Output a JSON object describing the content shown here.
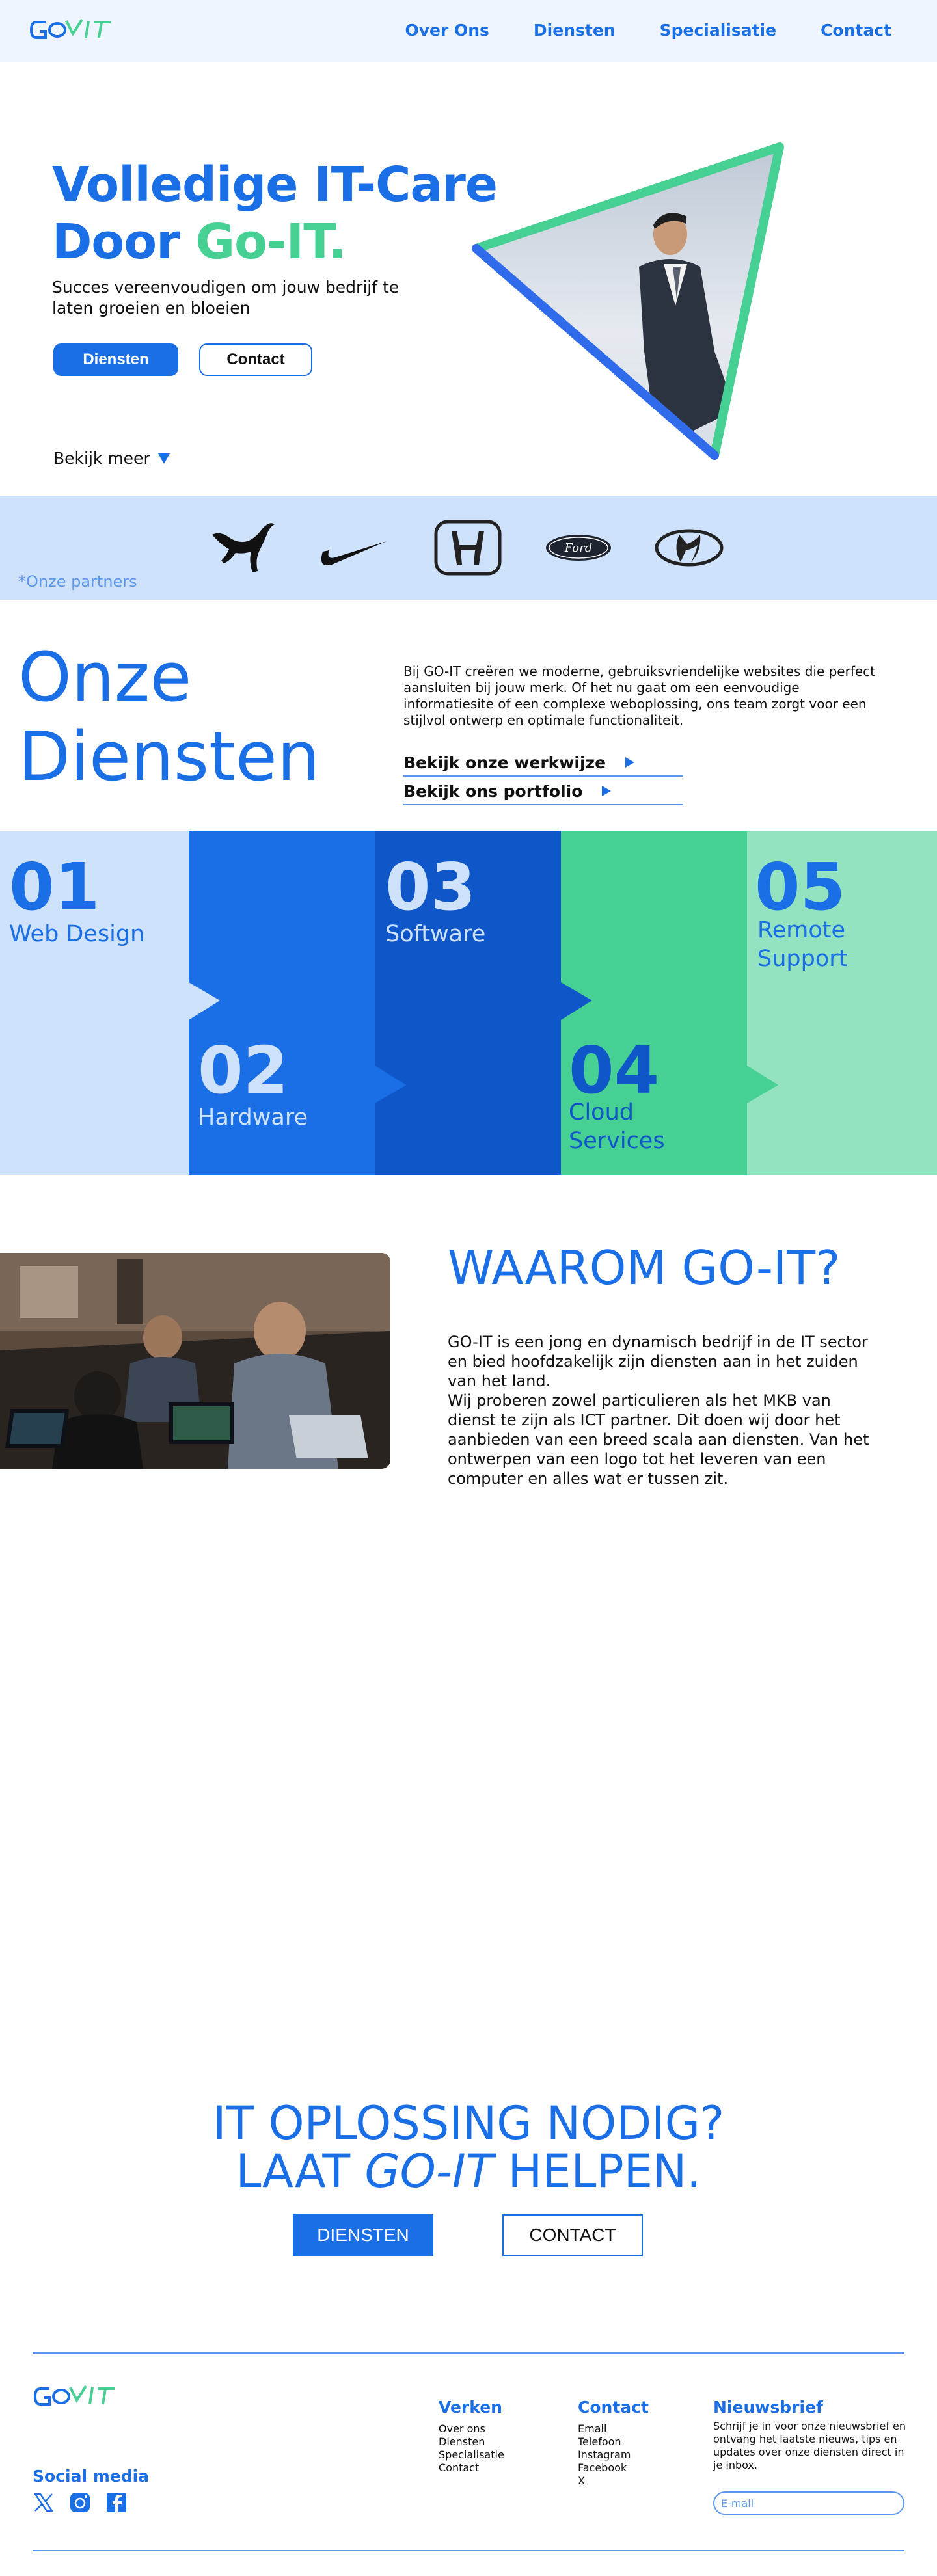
{
  "colors": {
    "primary": "#1A6FE6",
    "accent": "#47D093",
    "light_blue": "#CFE2FC",
    "header_bg": "#EEF5FF"
  },
  "header": {
    "logo_text": "GO-IT",
    "nav": [
      "Over Ons",
      "Diensten",
      "Specialisatie",
      "Contact"
    ]
  },
  "hero": {
    "title_line1": "Volledige IT-Care",
    "title_line2_prefix": "Door ",
    "title_line2_accent": "Go-IT.",
    "subtitle": "Succes vereenvoudigen om jouw bedrijf te laten groeien en bloeien",
    "btn_primary": "Diensten",
    "btn_secondary": "Contact",
    "bekijk": "Bekijk meer"
  },
  "partners": {
    "logos": [
      "puma-logo",
      "nike-logo",
      "honda-logo",
      "ford-logo",
      "hyundai-logo"
    ],
    "note": "*Onze partners"
  },
  "diensten": {
    "title_line1": "Onze",
    "title_line2": "Diensten",
    "text": "Bij GO-IT creëren we moderne, gebruiksvriendelijke websites die perfect aansluiten bij jouw merk. Of het nu gaat om een eenvoudige informatiesite of een complexe weboplossing, ons team zorgt voor een stijlvol ontwerp en optimale functionaliteit.",
    "link1": "Bekijk onze werkwijze",
    "link2": "Bekijk ons portfolio"
  },
  "services": [
    {
      "num": "01",
      "name": "Web Design"
    },
    {
      "num": "02",
      "name": "Hardware"
    },
    {
      "num": "03",
      "name": "Software"
    },
    {
      "num": "04",
      "name_line1": "Cloud",
      "name_line2": "Services"
    },
    {
      "num": "05",
      "name_line1": "Remote",
      "name_line2": "Support"
    }
  ],
  "waarom": {
    "title": "WAAROM GO-IT?",
    "text": "GO-IT is een jong en dynamisch bedrijf in de IT sector en bied hoofdzakelijk zijn diensten aan in het zuiden van het land.\nWij proberen zowel particulieren als het MKB van dienst te zijn als ICT partner. Dit doen wij door het aanbieden van een  breed scala aan diensten. Van het ontwerpen van een logo tot het leveren van een computer en alles wat er tussen zit."
  },
  "cta": {
    "line1": "IT OPLOSSING NODIG?",
    "line2_prefix": "LAAT ",
    "line2_it": "GO-IT",
    "line2_suffix": " HELPEN.",
    "btn1": "DIENSTEN",
    "btn2": "CONTACT"
  },
  "footer": {
    "social_title": "Social media",
    "social_icons": [
      "x-icon",
      "instagram-icon",
      "facebook-icon"
    ],
    "verken_title": "Verken",
    "verken": [
      "Over ons",
      "Diensten",
      "Specialisatie",
      "Contact"
    ],
    "contact_title": "Contact",
    "contact": [
      "Email",
      "Telefoon",
      "Instagram",
      "Facebook",
      "X"
    ],
    "news_title": "Nieuwsbrief",
    "news_text": "Schrijf je in voor onze nieuwsbrief en ontvang het laatste nieuws, tips en updates over onze diensten direct in je inbox.",
    "email_placeholder": "E-mail"
  }
}
